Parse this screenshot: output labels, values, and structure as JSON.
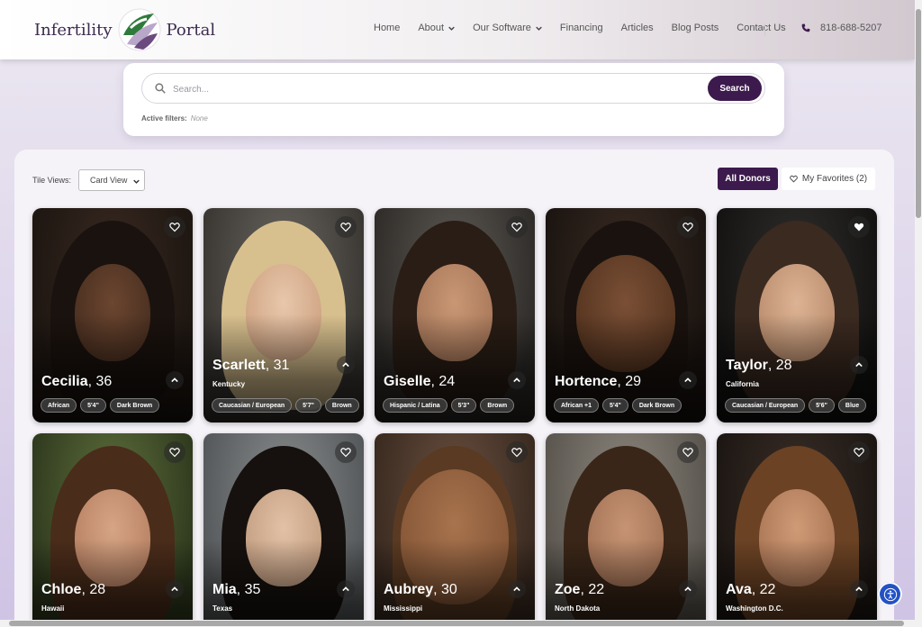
{
  "logo": {
    "left": "Infertility",
    "right": "Portal"
  },
  "nav": [
    {
      "label": "Home",
      "dropdown": false
    },
    {
      "label": "About",
      "dropdown": true
    },
    {
      "label": "Our Software",
      "dropdown": true
    },
    {
      "label": "Financing",
      "dropdown": false
    },
    {
      "label": "Articles",
      "dropdown": false
    },
    {
      "label": "Blog Posts",
      "dropdown": false
    },
    {
      "label": "Contact Us",
      "dropdown": false
    }
  ],
  "phone": "818-688-5207",
  "search": {
    "placeholder": "Search...",
    "button": "Search"
  },
  "filters": {
    "label": "Active filters:",
    "value": "None"
  },
  "tile_views": {
    "label": "Tile Views:",
    "selected": "Card View"
  },
  "tabs": {
    "all": "All Donors",
    "favorites": "My Favorites (2)"
  },
  "colors": {
    "accent": "#3d1a4d",
    "a11y": "#2352c4"
  },
  "donors": [
    {
      "name": "Cecilia",
      "age": ", 36",
      "location": "",
      "tags": [
        "African",
        "5'4\"",
        "Dark Brown"
      ],
      "favorite": false
    },
    {
      "name": "Scarlett",
      "age": ", 31",
      "location": "Kentucky",
      "tags": [
        "Caucasian / European",
        "5'7\"",
        "Brown"
      ],
      "favorite": false
    },
    {
      "name": "Giselle",
      "age": ", 24",
      "location": "",
      "tags": [
        "Hispanic / Latina",
        "5'3\"",
        "Brown"
      ],
      "favorite": false
    },
    {
      "name": "Hortence",
      "age": ", 29",
      "location": "",
      "tags": [
        "African +1",
        "5'4\"",
        "Dark Brown"
      ],
      "favorite": false
    },
    {
      "name": "Taylor",
      "age": ", 28",
      "location": "California",
      "tags": [
        "Caucasian / European",
        "5'6\"",
        "Blue"
      ],
      "favorite": true
    },
    {
      "name": "Chloe",
      "age": ", 28",
      "location": "Hawaii",
      "tags": [],
      "favorite": false
    },
    {
      "name": "Mia",
      "age": ", 35",
      "location": "Texas",
      "tags": [],
      "favorite": false
    },
    {
      "name": "Aubrey",
      "age": ", 30",
      "location": "Mississippi",
      "tags": [],
      "favorite": false
    },
    {
      "name": "Zoe",
      "age": ", 22",
      "location": "North Dakota",
      "tags": [],
      "favorite": false
    },
    {
      "name": "Ava",
      "age": ", 22",
      "location": "Washington D.C.",
      "tags": [],
      "favorite": false
    }
  ]
}
